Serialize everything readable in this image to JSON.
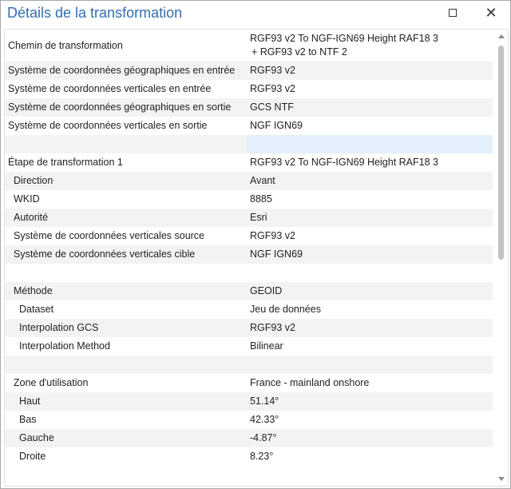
{
  "window": {
    "title": "Détails de la transformation"
  },
  "rows": [
    {
      "label": "Chemin de transformation",
      "value1": "RGF93 v2 To NGF-IGN69 Height RAF18 3",
      "value2": "+ RGF93 v2 to NTF 2"
    },
    {
      "label": "Système de coordonnées géographiques en entrée",
      "value": "RGF93 v2"
    },
    {
      "label": "Système de coordonnées verticales en entrée",
      "value": "RGF93 v2"
    },
    {
      "label": "Système de coordonnées géographiques en sortie",
      "value": "GCS NTF"
    },
    {
      "label": "Système de coordonnées verticales en sortie",
      "value": "NGF IGN69"
    },
    {
      "label": "Étape de transformation 1",
      "value": "RGF93 v2 To NGF-IGN69 Height RAF18 3"
    },
    {
      "label": "Direction",
      "value": "Avant"
    },
    {
      "label": "WKID",
      "value": "8885"
    },
    {
      "label": "Autorité",
      "value": "Esri"
    },
    {
      "label": "Système de coordonnées verticales source",
      "value": "RGF93 v2"
    },
    {
      "label": "Système de coordonnées verticales cible",
      "value": "NGF IGN69"
    },
    {
      "label": "Méthode",
      "value": "GEOID"
    },
    {
      "label": "Dataset",
      "value": "Jeu de données"
    },
    {
      "label": "Interpolation GCS",
      "value": "RGF93 v2"
    },
    {
      "label": "Interpolation Method",
      "value": "Bilinear"
    },
    {
      "label": "Zone d'utilisation",
      "value": "France - mainland onshore"
    },
    {
      "label": "Haut",
      "value": "51.14°"
    },
    {
      "label": "Bas",
      "value": "42.33°"
    },
    {
      "label": "Gauche",
      "value": "-4.87°"
    },
    {
      "label": "Droite",
      "value": "8.23°"
    }
  ],
  "colors": {
    "title": "#2f6fb3",
    "row_alt": "#f3f3f3",
    "selection": "#e3f0fb",
    "scroll_thumb": "#c2c2c2"
  },
  "icons": {
    "maximize": "maximize-icon",
    "close": "close-icon"
  }
}
